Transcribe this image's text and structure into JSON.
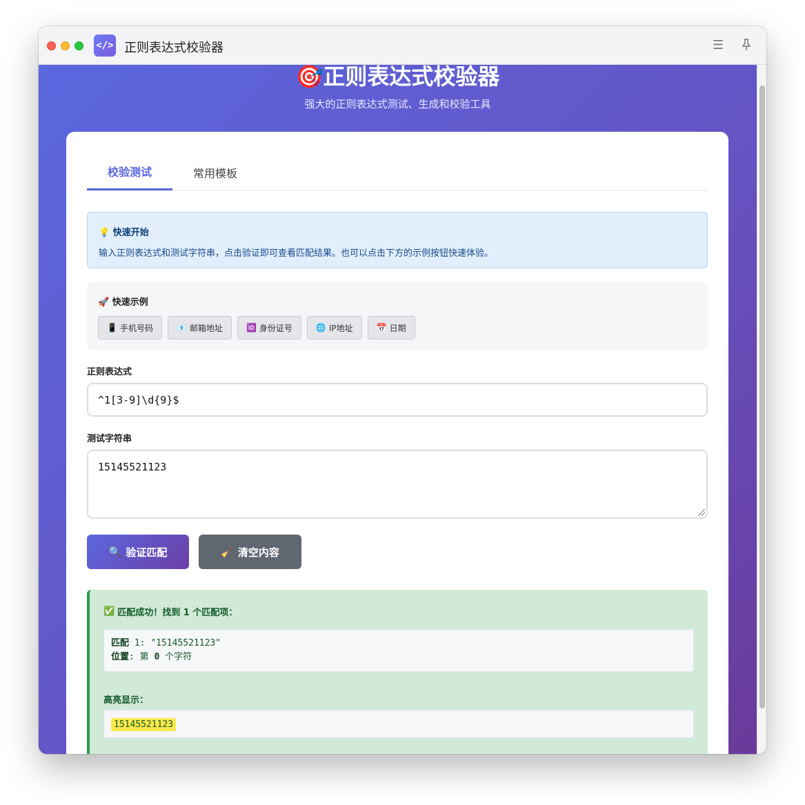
{
  "window": {
    "title": "正则表达式校验器",
    "icon": "code-brackets-icon",
    "icon_glyph": "</>"
  },
  "hero": {
    "emoji": "🎯",
    "title": "正则表达式校验器",
    "subtitle": "强大的正则表达式测试、生成和校验工具"
  },
  "tabs": [
    {
      "label": "校验测试",
      "active": true
    },
    {
      "label": "常用模板",
      "active": false
    }
  ],
  "info": {
    "emoji": "💡",
    "title": "快速开始",
    "text": "输入正则表达式和测试字符串，点击验证即可查看匹配结果。也可以点击下方的示例按钮快速体验。"
  },
  "examples": {
    "emoji": "🚀",
    "title": "快速示例",
    "buttons": [
      {
        "emoji": "📱",
        "label": "手机号码"
      },
      {
        "emoji": "📧",
        "label": "邮箱地址"
      },
      {
        "emoji": "🆔",
        "label": "身份证号"
      },
      {
        "emoji": "🌐",
        "label": "IP地址"
      },
      {
        "emoji": "📅",
        "label": "日期"
      }
    ]
  },
  "regex": {
    "label": "正则表达式",
    "value": "^1[3-9]\\d{9}$"
  },
  "test": {
    "label": "测试字符串",
    "value": "15145521123"
  },
  "actions": {
    "verify_emoji": "🔍",
    "verify_label": "验证匹配",
    "clear_emoji": "🧹",
    "clear_label": "清空内容"
  },
  "result": {
    "emoji": "✅",
    "title": "匹配成功！找到 1 个匹配项：",
    "match_label": "匹配",
    "match_index": "1",
    "match_value": "\"15145521123\"",
    "position_label": "位置",
    "position_prefix": "第",
    "position_value": "0",
    "position_suffix": "个字符",
    "highlight_label": "高亮显示：",
    "highlight_value": "15145521123"
  },
  "colors": {
    "accent": "#5b67df",
    "success": "#2a9a46",
    "highlight": "#fbe94a"
  }
}
